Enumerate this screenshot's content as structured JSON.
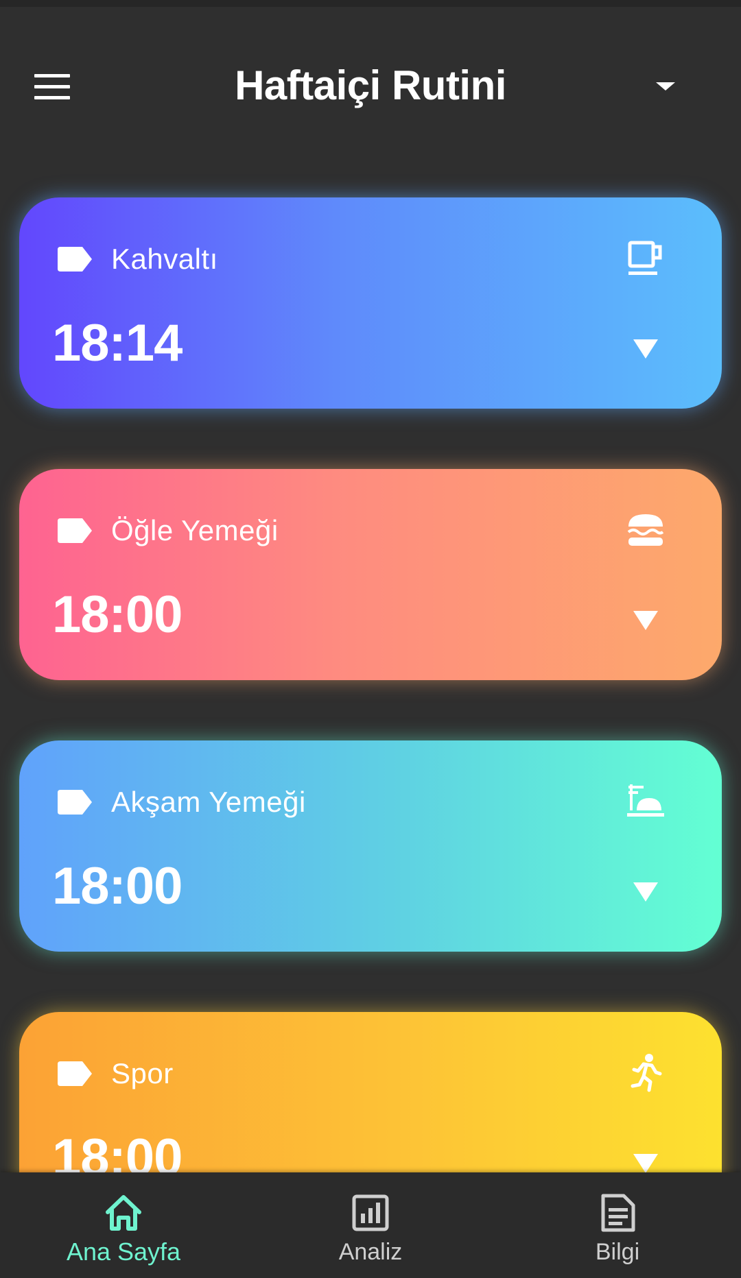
{
  "header": {
    "title": "Haftaiçi Rutini",
    "menu_icon": "hamburger-menu-icon",
    "dropdown_icon": "caret-down-icon"
  },
  "routines": [
    {
      "label": "Kahvaltı",
      "time": "18:14",
      "icon": "coffee-cup-icon",
      "gradient": [
        "#6247fd",
        "#5f8afb",
        "#5bbefc"
      ]
    },
    {
      "label": "Öğle Yemeği",
      "time": "18:00",
      "icon": "burger-icon",
      "gradient": [
        "#fe6391",
        "#fe8b80",
        "#fda96b"
      ]
    },
    {
      "label": "Akşam Yemeği",
      "time": "18:00",
      "icon": "dinner-service-icon",
      "gradient": [
        "#60a2fb",
        "#5fd2e2",
        "#63ffd3"
      ]
    },
    {
      "label": "Spor",
      "time": "18:00",
      "icon": "running-person-icon",
      "gradient": [
        "#fca235",
        "#fdc336",
        "#fde12f"
      ]
    }
  ],
  "bottom_nav": {
    "items": [
      {
        "label": "Ana Sayfa",
        "icon": "home-icon",
        "active": true
      },
      {
        "label": "Analiz",
        "icon": "bar-chart-icon",
        "active": false
      },
      {
        "label": "Bilgi",
        "icon": "document-icon",
        "active": false
      }
    ]
  },
  "colors": {
    "background": "#2f2f2f",
    "nav_background": "#2b2b2b",
    "accent": "#6ff3cf",
    "inactive": "#cfcfcf"
  }
}
